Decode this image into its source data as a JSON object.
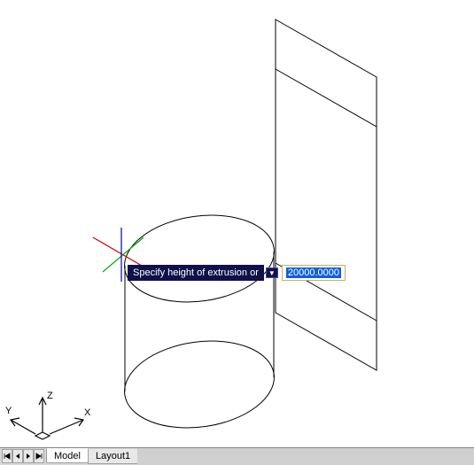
{
  "prompt": {
    "label": "Specify height of extrusion or",
    "value": "20000.0000"
  },
  "tabs": {
    "model": "Model",
    "layout1": "Layout1"
  },
  "ucs": {
    "x": "X",
    "y": "Y",
    "z": "Z"
  },
  "colors": {
    "prompt_bg": "#10104a",
    "selection": "#1060e0",
    "input_border": "#c8b060"
  }
}
